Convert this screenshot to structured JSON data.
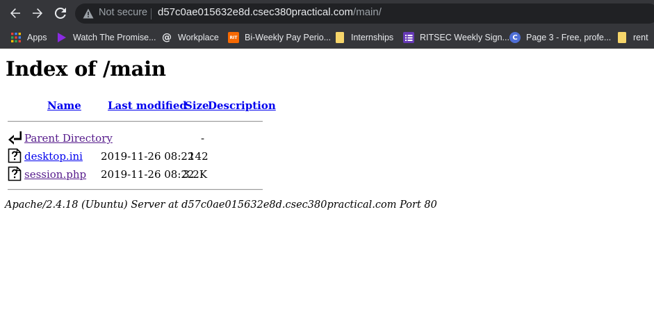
{
  "browser": {
    "security_label": "Not secure",
    "url_host": "d57c0ae015632e8d.csec380practical.com",
    "url_path": "/main/",
    "nav_icons": [
      "back-arrow-icon",
      "forward-arrow-icon",
      "reload-icon"
    ],
    "bookmarks": [
      {
        "label": "Apps",
        "icon": "apps-grid-icon"
      },
      {
        "label": "Watch The Promise...",
        "icon": "play-triangle-icon",
        "color": "#8a2be2"
      },
      {
        "label": "Workplace",
        "icon": "workplace-at-icon"
      },
      {
        "label": "Bi-Weekly Pay Perio...",
        "icon": "rit-logo-icon",
        "badge": "RIT",
        "color": "#f76902"
      },
      {
        "label": "Internships",
        "icon": "folder-icon",
        "color": "#f6d56a"
      },
      {
        "label": "RITSEC Weekly Sign...",
        "icon": "form-list-icon",
        "color": "#673ab7"
      },
      {
        "label": "Page 3 - Free, profe...",
        "icon": "c-circle-icon",
        "badge": "C",
        "color": "#4f6fd6"
      },
      {
        "label": "rent",
        "icon": "folder-icon",
        "color": "#f6d56a"
      }
    ]
  },
  "page": {
    "title": "Index of /main",
    "columns": {
      "name": "Name",
      "last_modified": "Last modified",
      "size": "Size",
      "description": "Description"
    },
    "rows": [
      {
        "name": "Parent Directory",
        "modified": "",
        "size": "-",
        "icon": "parent-directory-icon",
        "visited": true
      },
      {
        "name": "desktop.ini",
        "modified": "2019-11-26 08:22",
        "size": "142",
        "icon": "unknown-file-icon",
        "visited": false
      },
      {
        "name": "session.php",
        "modified": "2019-11-26 08:22",
        "size": "3.2K",
        "icon": "unknown-file-icon",
        "visited": true
      }
    ],
    "footer": "Apache/2.4.18 (Ubuntu) Server at d57c0ae015632e8d.csec380practical.com Port 80"
  }
}
